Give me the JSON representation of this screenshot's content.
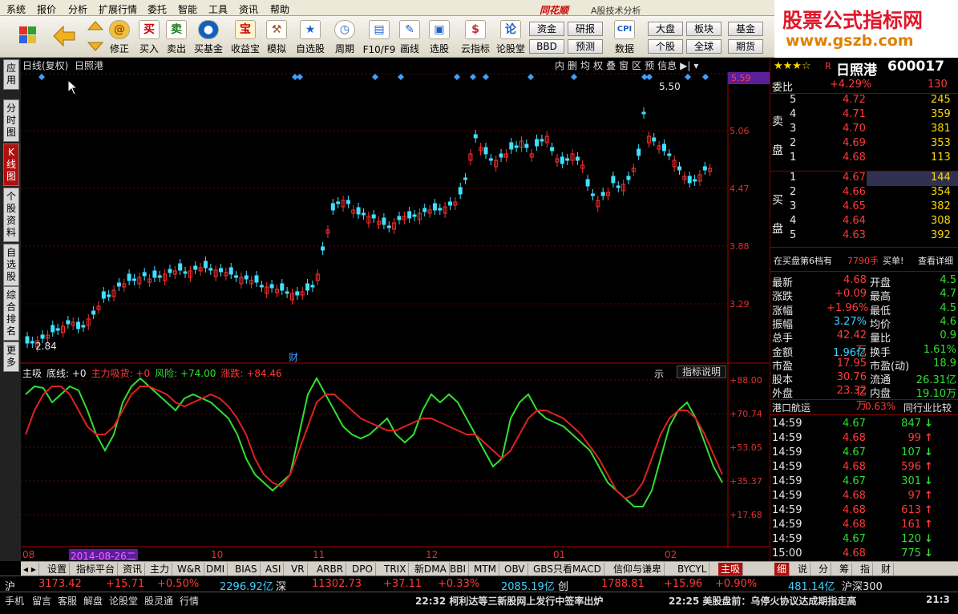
{
  "menu": [
    "系统",
    "报价",
    "分析",
    "扩展行情",
    "委托",
    "智能",
    "工具",
    "资讯",
    "帮助"
  ],
  "app": {
    "name": "同花顺",
    "sub": "A股技术分析"
  },
  "toolbar": {
    "items": [
      "修正",
      "买入",
      "卖出",
      "买基金",
      "收益宝",
      "模拟",
      "自选股",
      "周期",
      "F10/F9",
      "画线",
      "选股",
      "云指标",
      "论股堂"
    ],
    "icons": [
      "买",
      "卖",
      "宝"
    ],
    "small": [
      "资金",
      "研报",
      "BBD",
      "预测",
      "数据",
      "大盘",
      "板块",
      "基金",
      "个股",
      "全球",
      "期货"
    ]
  },
  "logo": {
    "line1": "股票公式指标网",
    "line2": "www.gszb.com"
  },
  "lefttabs": [
    "应用",
    "分时图",
    "K线图",
    "个股资料",
    "自选股",
    "综合排名",
    "更多"
  ],
  "chart": {
    "title": "日线(复权)",
    "name": "日照港",
    "top_buttons": [
      "内",
      "删",
      "均",
      "权",
      "叠",
      "窗",
      "区",
      "预",
      "信息"
    ],
    "price_ticks": [
      "5.59",
      "5.06",
      "4.47",
      "3.88",
      "3.29"
    ],
    "high_label": "5.50",
    "low_label": "2.84",
    "cai_label": "财"
  },
  "indicator": {
    "items": [
      {
        "t": "主吸",
        "c": "#e8e8e8"
      },
      {
        "t": "底线: +0",
        "c": "#e8e8e8"
      },
      {
        "t": "主力吸货: +0",
        "c": "#ff3a3a"
      },
      {
        "t": "风险: +74.00",
        "c": "#2fe02f"
      },
      {
        "t": "涨跌: +84.46",
        "c": "#ff3a3a"
      }
    ],
    "scale": [
      "+88.00",
      "+70.74",
      "+53.05",
      "+35.37",
      "+17.68"
    ],
    "btn_label": "指标说明",
    "side": "示"
  },
  "xaxis": {
    "labels": [
      "08",
      "10",
      "11",
      "12",
      "01",
      "02"
    ],
    "selected_date": "2014-08-26二"
  },
  "stock": {
    "stars": "★★★☆",
    "code": "600017",
    "name": "日照港",
    "mark": "R"
  },
  "orderbook": {
    "weibi": {
      "label": "委比",
      "pct": "+4.29%",
      "num": "130"
    },
    "sell": [
      {
        "n": "5",
        "p": "4.72",
        "v": "245"
      },
      {
        "n": "4",
        "p": "4.71",
        "v": "359"
      },
      {
        "n": "3",
        "p": "4.70",
        "v": "381"
      },
      {
        "n": "2",
        "p": "4.69",
        "v": "353"
      },
      {
        "n": "1",
        "p": "4.68",
        "v": "113"
      }
    ],
    "buy": [
      {
        "n": "1",
        "p": "4.67",
        "v": "144"
      },
      {
        "n": "2",
        "p": "4.66",
        "v": "354"
      },
      {
        "n": "3",
        "p": "4.65",
        "v": "382"
      },
      {
        "n": "4",
        "p": "4.64",
        "v": "308"
      },
      {
        "n": "5",
        "p": "4.63",
        "v": "392"
      }
    ],
    "sell_label": "卖盘",
    "buy_label": "买盘"
  },
  "bigorder": {
    "text": "在买盘第6档有",
    "vol": "7790手",
    "kind": "买单!",
    "link": "查看详细"
  },
  "quote": [
    {
      "l": "最新",
      "v": "4.68",
      "l2": "开盘",
      "v2": "4.5"
    },
    {
      "l": "涨跌",
      "v": "+0.09",
      "l2": "最高",
      "v2": "4.7"
    },
    {
      "l": "涨幅",
      "v": "+1.96%",
      "l2": "最低",
      "v2": "4.5"
    },
    {
      "l": "振幅",
      "v": "3.27%",
      "l2": "均价",
      "v2": "4.6"
    },
    {
      "l": "总手",
      "v": "42.42万",
      "l2": "量比",
      "v2": "0.9"
    },
    {
      "l": "金额",
      "v": "1.96亿",
      "l2": "换手",
      "v2": "1.61%"
    },
    {
      "l": "市盈",
      "v": "17.95",
      "l2": "市盈(动)",
      "v2": "18.9"
    },
    {
      "l": "股本",
      "v": "30.76亿",
      "l2": "流通",
      "v2": "26.31亿"
    },
    {
      "l": "外盘",
      "v": "23.32万",
      "l2": "内盘",
      "v2": "19.10万"
    }
  ],
  "industry": {
    "name": "港口航运",
    "pct": "0.63%",
    "btn": "同行业比较"
  },
  "ticks": [
    {
      "t": "14:59",
      "p": "4.67",
      "v": "847",
      "d": "down"
    },
    {
      "t": "14:59",
      "p": "4.68",
      "v": "99",
      "d": "up"
    },
    {
      "t": "14:59",
      "p": "4.67",
      "v": "107",
      "d": "down"
    },
    {
      "t": "14:59",
      "p": "4.68",
      "v": "596",
      "d": "up"
    },
    {
      "t": "14:59",
      "p": "4.67",
      "v": "301",
      "d": "down"
    },
    {
      "t": "14:59",
      "p": "4.68",
      "v": "97",
      "d": "up"
    },
    {
      "t": "14:59",
      "p": "4.68",
      "v": "613",
      "d": "up"
    },
    {
      "t": "14:59",
      "p": "4.68",
      "v": "161",
      "d": "up"
    },
    {
      "t": "14:59",
      "p": "4.67",
      "v": "120",
      "d": "down"
    },
    {
      "t": "15:00",
      "p": "4.68",
      "v": "775",
      "d": "down"
    }
  ],
  "bottomtabs": [
    "设置",
    "指标平台",
    "资讯",
    "主力",
    "W&R",
    "DMI",
    "BIAS",
    "ASI",
    "VR",
    "ARBR",
    "DPO",
    "TRIX",
    "新DMA",
    "BBI",
    "MTM",
    "OBV",
    "GBS只看MACD",
    "信仰与谦卑",
    "BYCYL",
    "主吸"
  ],
  "righttabs": [
    "细",
    "说",
    "分",
    "筹",
    "指",
    "财"
  ],
  "index": {
    "sh": {
      "name": "沪",
      "val": "3173.42",
      "chg": "+15.71",
      "pct": "+0.50%",
      "amt": "2296.92亿"
    },
    "sz": {
      "name": "深",
      "val": "11302.73",
      "chg": "+37.11",
      "pct": "+0.33%",
      "amt": "2085.19亿"
    },
    "cy": {
      "name": "创",
      "val": "1788.81",
      "chg": "+15.96",
      "pct": "+0.90%",
      "amt": "481.14亿"
    },
    "hs300": "沪深300"
  },
  "status": {
    "items": [
      "手机",
      "留言",
      "客服",
      "解盘",
      "论股堂",
      "股灵通",
      "行情"
    ],
    "news1": "22:32 柯利达等三新股网上发行中签率出炉",
    "news2": "22:25 美股盘前：乌停火协议达成期指走高",
    "time": "21:3"
  }
}
